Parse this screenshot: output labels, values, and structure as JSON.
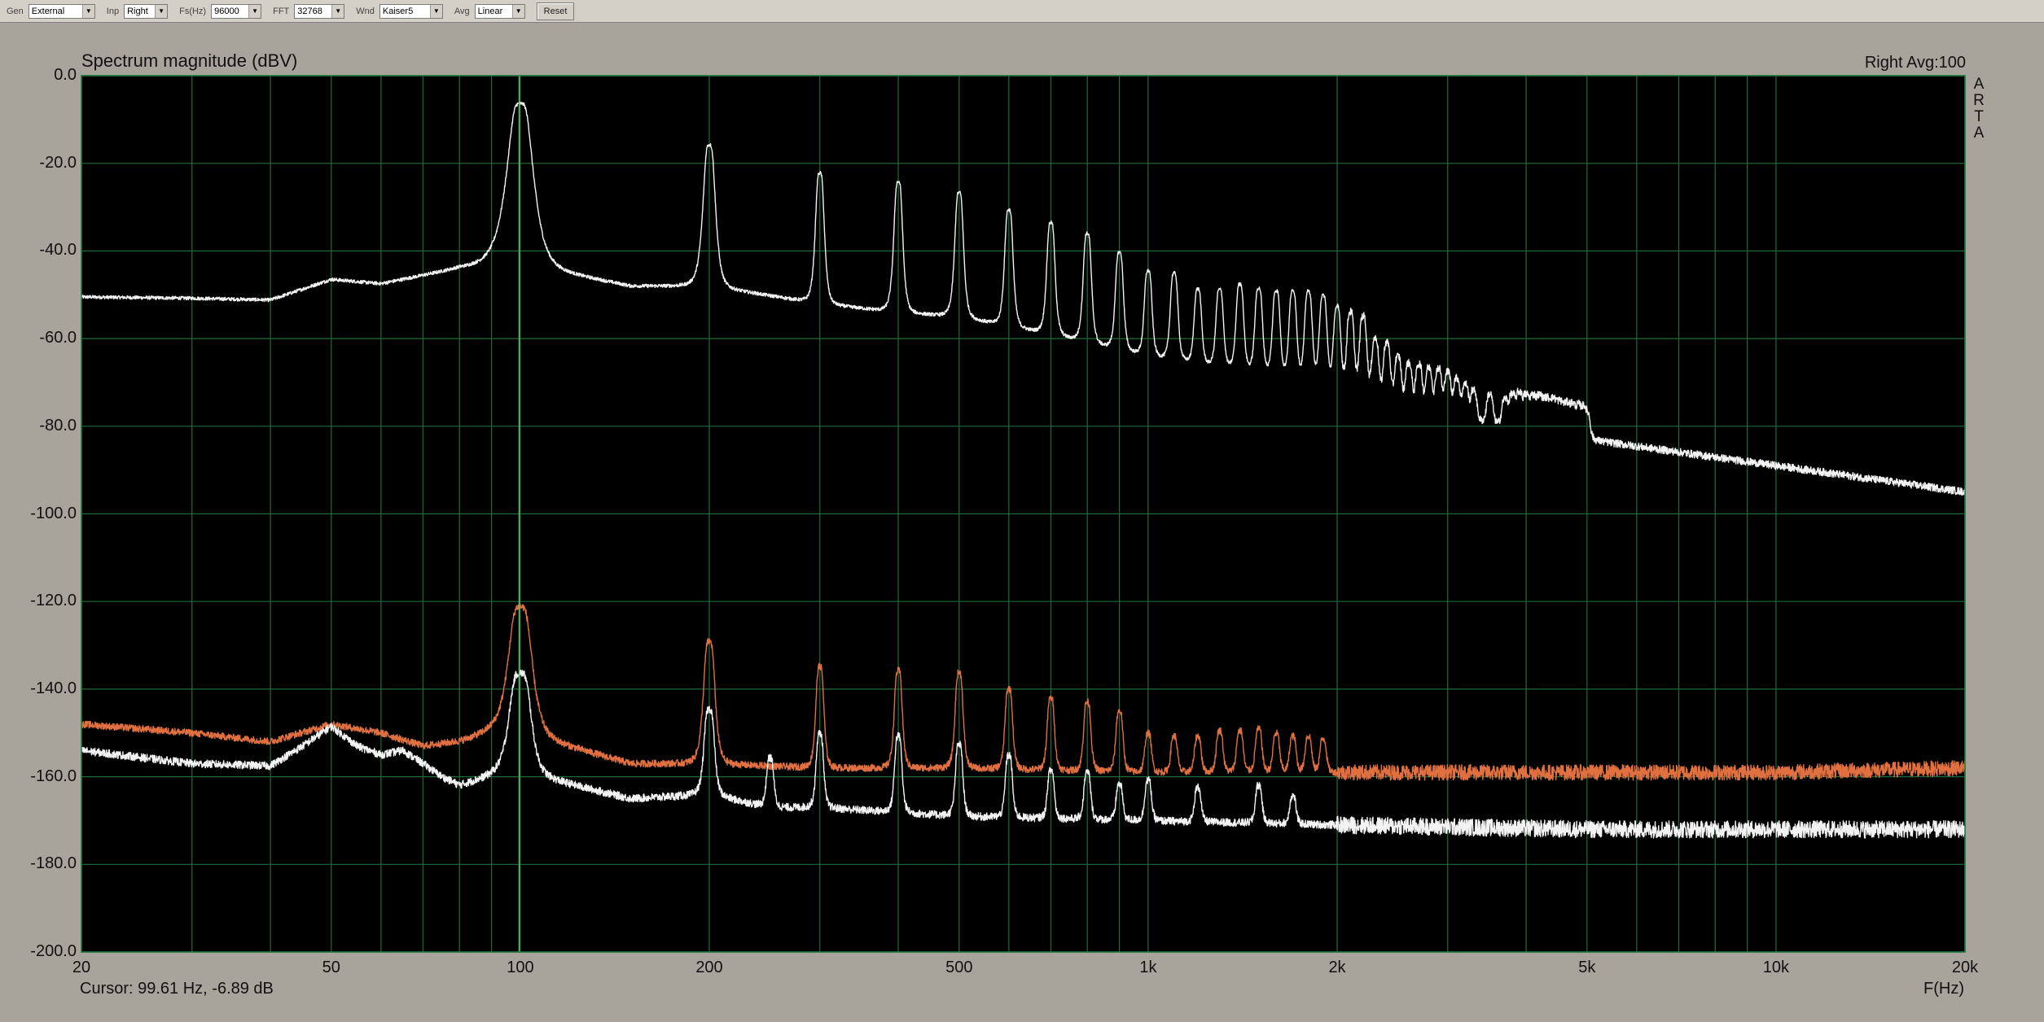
{
  "toolbar": {
    "gen_label": "Gen",
    "gen_value": "External",
    "inp_label": "Inp",
    "inp_value": "Right",
    "fs_label": "Fs(Hz)",
    "fs_value": "96000",
    "fft_label": "FFT",
    "fft_value": "32768",
    "wnd_label": "Wnd",
    "wnd_value": "Kaiser5",
    "avg_label": "Avg",
    "avg_value": "Linear",
    "reset_label": "Reset"
  },
  "header": {
    "title": "Spectrum magnitude (dBV)",
    "channel_info": "Right   Avg:100",
    "logo_letters": [
      "A",
      "R",
      "T",
      "A"
    ]
  },
  "footer": {
    "cursor_readout": "Cursor: 99.61 Hz, -6.89 dB",
    "x_unit": "F(Hz)"
  },
  "colors": {
    "plot_background": "#000000",
    "grid": "#1e6b3a",
    "cursor_line": "#6fb86f",
    "series_main": "#f2f2f2",
    "series_orange": "#e07040",
    "series_white_low": "#f2f2f2"
  },
  "chart_data": {
    "type": "line",
    "title": "Spectrum magnitude (dBV)",
    "xlabel": "F(Hz)",
    "ylabel": "",
    "x_scale": "log",
    "xlim": [
      20,
      20000
    ],
    "ylim": [
      -200,
      0
    ],
    "grid": true,
    "x_tick_values": [
      20,
      50,
      100,
      200,
      500,
      1000,
      2000,
      5000,
      10000,
      20000
    ],
    "x_tick_labels": [
      "20",
      "50",
      "100",
      "200",
      "500",
      "1k",
      "2k",
      "5k",
      "10k",
      "20k"
    ],
    "y_tick_values": [
      0,
      -20,
      -40,
      -60,
      -80,
      -100,
      -120,
      -140,
      -160,
      -180,
      -200
    ],
    "y_tick_labels": [
      "0.0",
      "-20.0",
      "-40.0",
      "-60.0",
      "-80.0",
      "-100.0",
      "-120.0",
      "-140.0",
      "-160.0",
      "-180.0",
      "-200.0"
    ],
    "cursor_x": 99.61,
    "series": [
      {
        "color": "#f2f2f2",
        "noise": 0.4,
        "floor": [
          [
            20,
            -50.5
          ],
          [
            30,
            -50.8
          ],
          [
            40,
            -51.2
          ],
          [
            50,
            -46.5
          ],
          [
            60,
            -47.5
          ],
          [
            80,
            -44
          ],
          [
            100,
            -43
          ],
          [
            150,
            -48
          ],
          [
            200,
            -48
          ],
          [
            300,
            -52
          ],
          [
            400,
            -54
          ],
          [
            500,
            -55
          ],
          [
            700,
            -59
          ],
          [
            1000,
            -64
          ],
          [
            1500,
            -68
          ],
          [
            2000,
            -72
          ],
          [
            3000,
            -78
          ],
          [
            5000,
            -83
          ],
          [
            10000,
            -89
          ],
          [
            20000,
            -95
          ]
        ],
        "peaks": [
          [
            100,
            -6.5
          ],
          [
            200,
            -16
          ],
          [
            300,
            -22.5
          ],
          [
            400,
            -24.5
          ],
          [
            500,
            -27
          ],
          [
            600,
            -31
          ],
          [
            700,
            -34
          ],
          [
            800,
            -36.5
          ],
          [
            900,
            -41
          ],
          [
            1000,
            -45.5
          ],
          [
            1100,
            -46
          ],
          [
            1200,
            -50
          ],
          [
            1300,
            -50
          ],
          [
            1400,
            -48.5
          ],
          [
            1500,
            -49.5
          ],
          [
            1600,
            -50
          ],
          [
            1700,
            -50
          ],
          [
            1800,
            -50
          ],
          [
            1900,
            -51
          ],
          [
            2000,
            -54
          ],
          [
            2100,
            -55
          ],
          [
            2200,
            -56
          ],
          [
            2300,
            -62
          ],
          [
            2400,
            -63
          ],
          [
            2500,
            -67
          ],
          [
            2600,
            -69
          ],
          [
            2700,
            -69
          ],
          [
            2800,
            -70
          ],
          [
            2900,
            -70
          ],
          [
            3000,
            -71
          ],
          [
            3100,
            -73
          ],
          [
            3200,
            -75
          ],
          [
            3300,
            -77
          ],
          [
            3500,
            -78
          ],
          [
            3700,
            -80
          ],
          [
            3800,
            -78
          ],
          [
            3900,
            -77
          ],
          [
            4000,
            -78
          ],
          [
            4100,
            -78
          ],
          [
            4200,
            -78
          ],
          [
            4300,
            -79
          ],
          [
            4400,
            -79
          ],
          [
            4500,
            -80
          ],
          [
            4600,
            -81
          ],
          [
            4700,
            -81
          ],
          [
            4800,
            -82
          ],
          [
            4900,
            -82
          ],
          [
            5000,
            -83
          ]
        ]
      },
      {
        "color": "#e07040",
        "noise": 0.8,
        "floor": [
          [
            20,
            -148
          ],
          [
            30,
            -150
          ],
          [
            40,
            -152
          ],
          [
            50,
            -148
          ],
          [
            60,
            -150
          ],
          [
            70,
            -153
          ],
          [
            80,
            -152
          ],
          [
            90,
            -150
          ],
          [
            100,
            -150
          ],
          [
            150,
            -157
          ],
          [
            200,
            -157
          ],
          [
            300,
            -158
          ],
          [
            500,
            -158
          ],
          [
            1000,
            -159
          ],
          [
            2000,
            -159
          ],
          [
            5000,
            -159
          ],
          [
            10000,
            -159
          ],
          [
            20000,
            -158
          ]
        ],
        "peaks": [
          [
            100,
            -121.5
          ],
          [
            200,
            -129.5
          ],
          [
            300,
            -135.5
          ],
          [
            400,
            -136.5
          ],
          [
            500,
            -137
          ],
          [
            600,
            -141
          ],
          [
            700,
            -143.5
          ],
          [
            800,
            -144.5
          ],
          [
            900,
            -147
          ],
          [
            1000,
            -154
          ],
          [
            1100,
            -155
          ],
          [
            1200,
            -155
          ],
          [
            1300,
            -153
          ],
          [
            1400,
            -153
          ],
          [
            1500,
            -152.5
          ],
          [
            1600,
            -154
          ],
          [
            1700,
            -155
          ],
          [
            1800,
            -155
          ],
          [
            1900,
            -156
          ]
        ]
      },
      {
        "color": "#f2f2f2",
        "noise": 0.9,
        "floor": [
          [
            20,
            -154
          ],
          [
            30,
            -157
          ],
          [
            40,
            -157.5
          ],
          [
            45,
            -153
          ],
          [
            50,
            -148.5
          ],
          [
            55,
            -153
          ],
          [
            60,
            -155
          ],
          [
            65,
            -154
          ],
          [
            70,
            -157
          ],
          [
            75,
            -160
          ],
          [
            80,
            -162
          ],
          [
            90,
            -160
          ],
          [
            100,
            -159
          ],
          [
            150,
            -165
          ],
          [
            200,
            -164
          ],
          [
            250,
            -167
          ],
          [
            300,
            -167
          ],
          [
            500,
            -169
          ],
          [
            1000,
            -170
          ],
          [
            2000,
            -171
          ],
          [
            5000,
            -172
          ],
          [
            10000,
            -172
          ],
          [
            20000,
            -172
          ]
        ],
        "peaks": [
          [
            100,
            -137
          ],
          [
            200,
            -145.5
          ],
          [
            250,
            -158.5
          ],
          [
            300,
            -151.5
          ],
          [
            400,
            -152
          ],
          [
            500,
            -154
          ],
          [
            600,
            -157
          ],
          [
            700,
            -161.5
          ],
          [
            800,
            -162
          ],
          [
            900,
            -166
          ],
          [
            1000,
            -164.5
          ],
          [
            1200,
            -167
          ],
          [
            1500,
            -166
          ],
          [
            1700,
            -170
          ]
        ]
      }
    ]
  }
}
